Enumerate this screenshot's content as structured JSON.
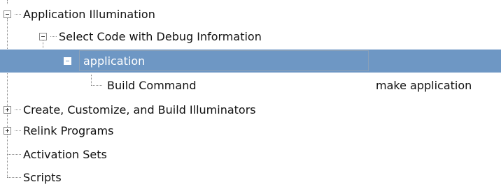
{
  "tree": {
    "root": {
      "label": "Application Illumination",
      "state": "expanded",
      "children": [
        {
          "label": "Select Code with Debug Information",
          "state": "expanded",
          "children": [
            {
              "label": "application",
              "state": "expanded",
              "selected": true,
              "children": [
                {
                  "label": "Build Command",
                  "value": "make application"
                }
              ]
            }
          ]
        },
        {
          "label": "Create, Customize, and Build Illuminators",
          "state": "collapsed"
        },
        {
          "label": "Relink Programs",
          "state": "collapsed"
        },
        {
          "label": "Activation Sets"
        },
        {
          "label": "Scripts"
        }
      ]
    }
  },
  "colors": {
    "selection": "#6e97c4",
    "tree_lines": "#8a8a8a"
  }
}
